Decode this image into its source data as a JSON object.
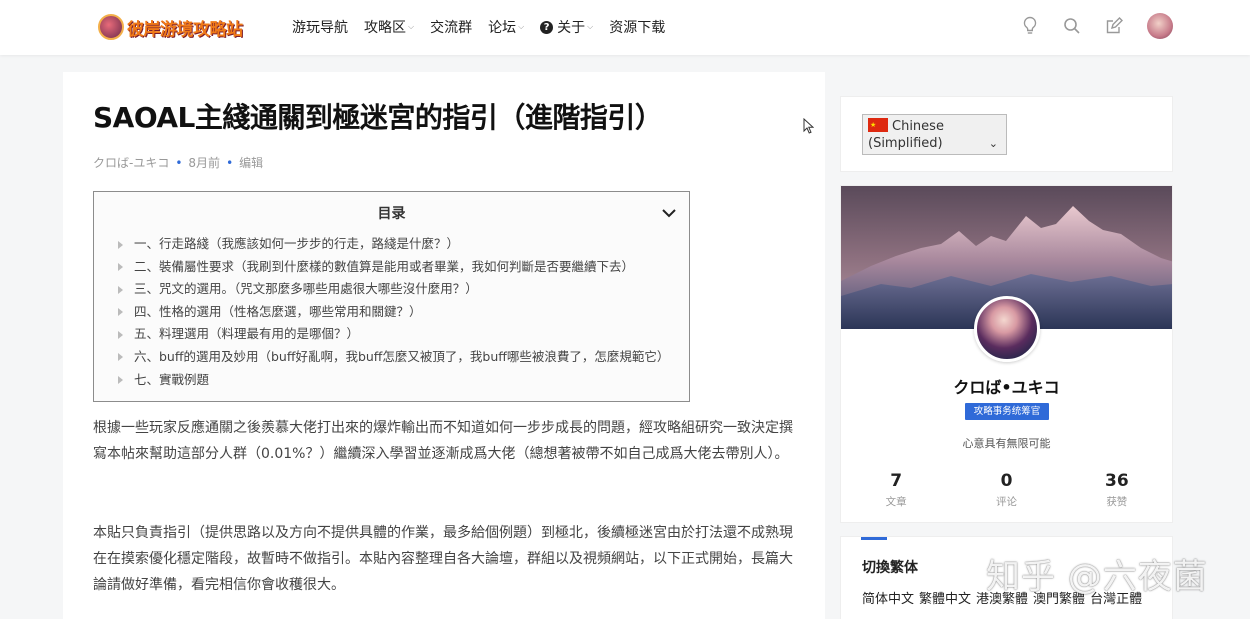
{
  "header": {
    "logo_text": "彼岸游境攻略站",
    "nav": [
      {
        "label": "游玩导航",
        "dropdown": false
      },
      {
        "label": "攻略区",
        "dropdown": true
      },
      {
        "label": "交流群",
        "dropdown": false
      },
      {
        "label": "论坛",
        "dropdown": true
      },
      {
        "label": "关于",
        "dropdown": true
      },
      {
        "label": "资源下载",
        "dropdown": false
      }
    ],
    "icons": [
      "lightbulb-icon",
      "search-icon",
      "edit-icon",
      "user-avatar"
    ]
  },
  "article": {
    "title": "SAOAL主綫通關到極迷宮的指引（進階指引）",
    "author": "クロば-ユキコ",
    "time": "8月前",
    "edit": "编辑",
    "toc": {
      "title": "目录",
      "items": [
        "一、行走路綫（我應該如何一步步的行走，路綫是什麼？）",
        "二、裝備屬性要求（我刷到什麼樣的數值算是能用或者畢業，我如何判斷是否要繼續下去）",
        "三、咒文的選用。（咒文那麼多哪些用處很大哪些沒什麼用？）",
        "四、性格的選用（性格怎麼選，哪些常用和關鍵？）",
        "五、料理選用（料理最有用的是哪個？）",
        "六、buff的選用及妙用（buff好亂啊，我buff怎麼又被頂了，我buff哪些被浪費了，怎麼規範它）",
        "七、實戰例題"
      ]
    },
    "paragraphs": [
      "根據一些玩家反應通關之後羨慕大佬打出來的爆炸輸出而不知道如何一步步成長的問題，經攻略組研究一致決定撰寫本帖來幫助這部分人群（0.01%？）繼續深入學習並逐漸成爲大佬（總想著被帶不如自己成爲大佬去帶別人）。",
      "本貼只負責指引（提供思路以及方向不提供具體的作業，最多給個例題）到極北，後續極迷宮由於打法還不成熟現在在摸索優化穩定階段，故暫時不做指引。本貼內容整理自各大論壇，群組以及視頻網站，以下正式開始，長篇大論請做好準備，看完相信你會收穫很大。"
    ]
  },
  "sidebar": {
    "language": {
      "line1": "Chinese",
      "line2": "(Simplified)"
    },
    "author": {
      "name": "クロば•ユキコ",
      "badge": "攻略事务统筹官",
      "bio": "心意具有無限可能",
      "stats": [
        {
          "value": "7",
          "label": "文章"
        },
        {
          "value": "0",
          "label": "评论"
        },
        {
          "value": "36",
          "label": "获赞"
        }
      ]
    },
    "switch": {
      "title": "切換繁体",
      "options": [
        "简体中文",
        "繁體中文",
        "港澳繁體",
        "澳門繁體",
        "台灣正體"
      ]
    }
  },
  "watermark": "知乎 @六夜菌"
}
